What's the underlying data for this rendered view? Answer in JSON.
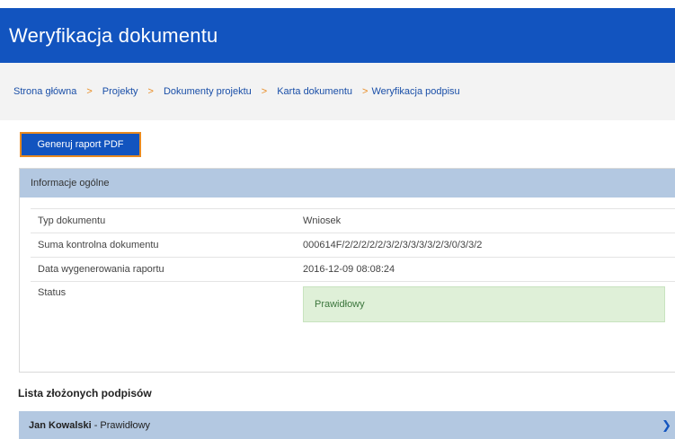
{
  "header": {
    "title": "Weryfikacja dokumentu"
  },
  "breadcrumb": {
    "separator": ">",
    "items": [
      "Strona główna",
      "Projekty",
      "Dokumenty projektu",
      "Karta dokumentu",
      "Weryfikacja podpisu"
    ]
  },
  "toolbar": {
    "pdf_button": "Generuj raport PDF"
  },
  "general_info": {
    "heading": "Informacje ogólne",
    "rows": [
      {
        "label": "Typ dokumentu",
        "value": "Wniosek"
      },
      {
        "label": "Suma kontrolna dokumentu",
        "value": "000614F/2/2/2/2/2/3/2/3/3/3/3/2/3/0/3/3/2"
      },
      {
        "label": "Data wygenerowania raportu",
        "value": "2016-12-09 08:08:24"
      }
    ],
    "status_label": "Status",
    "status_value": "Prawidłowy"
  },
  "signatures": {
    "heading": "Lista złożonych podpisów",
    "items": [
      {
        "name": "Jan Kowalski",
        "status": "- Prawidłowy"
      }
    ]
  },
  "colors": {
    "primary": "#1254bf",
    "accent": "#e98a1f",
    "panel_header": "#b3c8e1",
    "status_ok_bg": "#dff0d8",
    "status_ok_text": "#3c763d"
  }
}
